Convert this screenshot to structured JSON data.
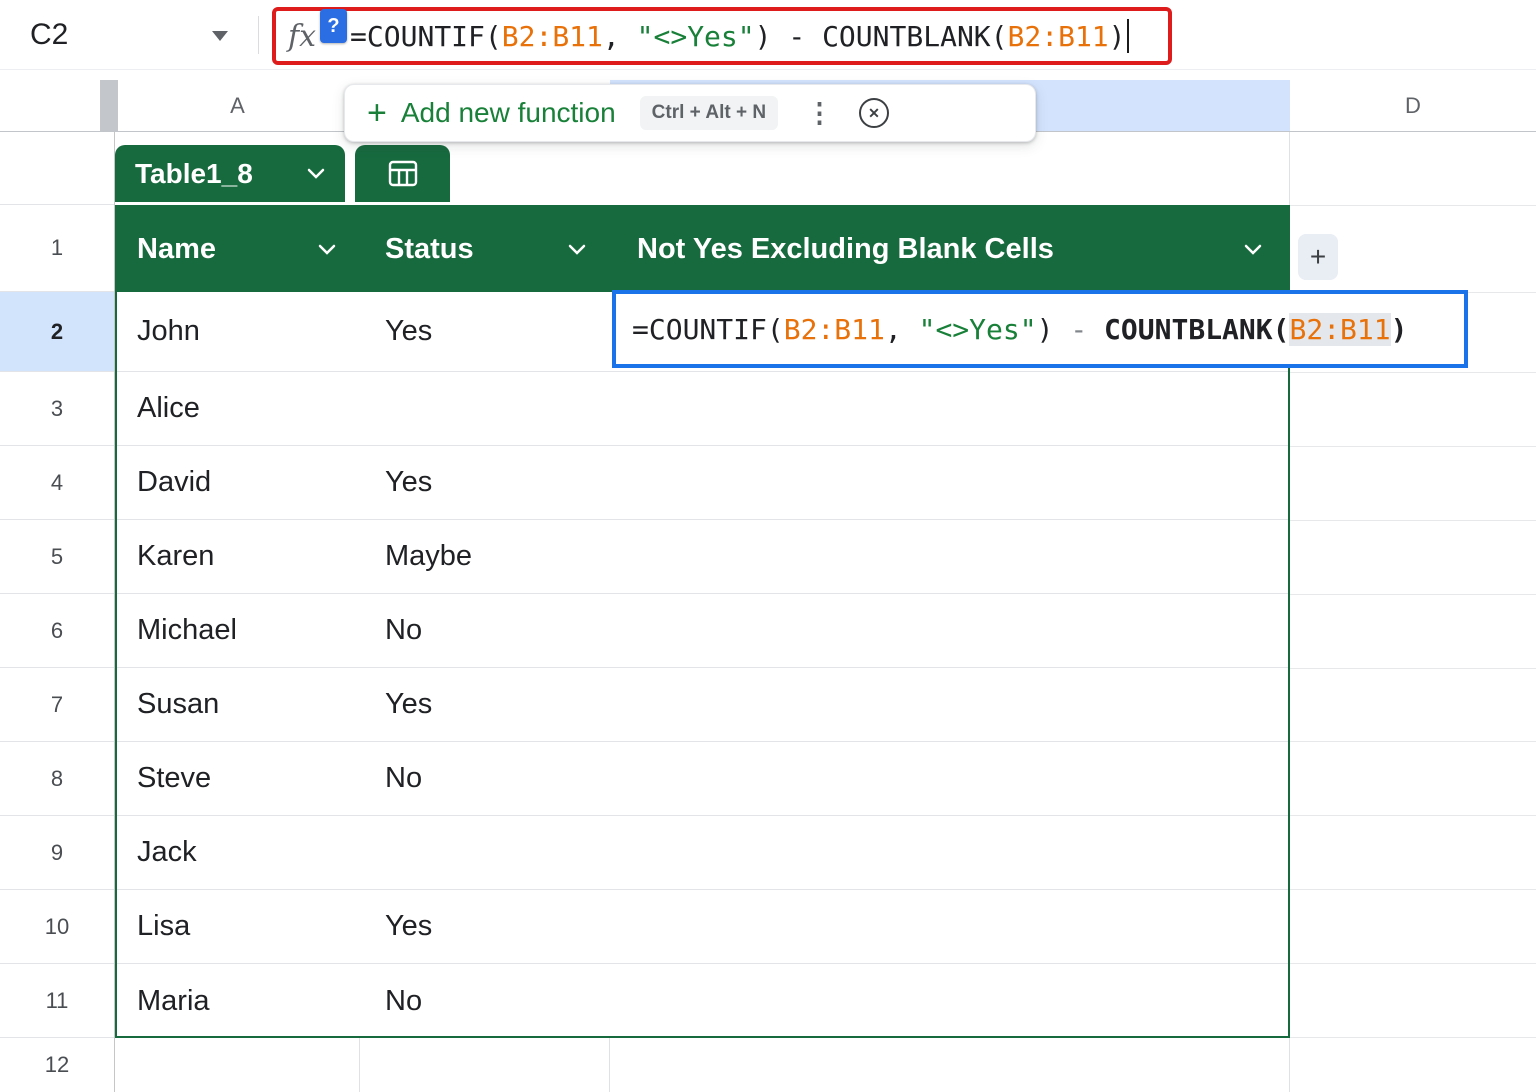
{
  "colors": {
    "ink": "#202124",
    "range_orange": "#e8710a",
    "string_green": "#188038",
    "operator_gray": "#80868b",
    "header_green": "#17693e",
    "selection_blue": "#1a73e8",
    "attention_red": "#de1c1c",
    "selected_row_fill": "#d2e3fc",
    "selected_col_fill": "#d3e3fd",
    "arg_highlight": "#e4e7eb"
  },
  "icons": {
    "plus": "+",
    "more_options": "⋮",
    "close": "✕"
  },
  "name_box": {
    "value": "C2"
  },
  "formula_bar": {
    "fx_label": "fx",
    "help_badge": "?",
    "tokens": [
      {
        "t": "=COUNTIF(",
        "c": "ink"
      },
      {
        "t": "B2:B11",
        "c": "range_orange"
      },
      {
        "t": ", ",
        "c": "ink"
      },
      {
        "t": "\"<>Yes\"",
        "c": "string_green"
      },
      {
        "t": ") ",
        "c": "ink"
      },
      {
        "t": "- ",
        "c": "ink"
      },
      {
        "t": "COUNTBLANK(",
        "c": "ink"
      },
      {
        "t": "B2:B11",
        "c": "range_orange"
      },
      {
        "t": ")",
        "c": "ink"
      }
    ]
  },
  "function_tooltip": {
    "add_label": "Add new function",
    "shortcut": "Ctrl + Alt + N"
  },
  "column_headers": {
    "a": "A",
    "d": "D"
  },
  "table": {
    "name": "Table1_8",
    "columns": [
      "Name",
      "Status",
      "Not Yes Excluding Blank Cells"
    ],
    "add_column_label": "+",
    "header_row_number": "1",
    "trailing_row_number": "12",
    "rows": [
      {
        "row": "2",
        "name": "John",
        "status": "Yes"
      },
      {
        "row": "3",
        "name": "Alice",
        "status": ""
      },
      {
        "row": "4",
        "name": "David",
        "status": "Yes"
      },
      {
        "row": "5",
        "name": "Karen",
        "status": "Maybe"
      },
      {
        "row": "6",
        "name": "Michael",
        "status": "No"
      },
      {
        "row": "7",
        "name": "Susan",
        "status": "Yes"
      },
      {
        "row": "8",
        "name": "Steve",
        "status": "No"
      },
      {
        "row": "9",
        "name": "Jack",
        "status": ""
      },
      {
        "row": "10",
        "name": "Lisa",
        "status": "Yes"
      },
      {
        "row": "11",
        "name": "Maria",
        "status": "No"
      }
    ]
  },
  "cell_editor": {
    "tokens": [
      {
        "t": "=COUNTIF(",
        "c": "ink"
      },
      {
        "t": "B2:B11",
        "c": "range_orange"
      },
      {
        "t": ", ",
        "c": "ink"
      },
      {
        "t": "\"<>Yes\"",
        "c": "string_green"
      },
      {
        "t": ") ",
        "c": "ink"
      },
      {
        "t": "- ",
        "c": "operator_gray"
      },
      {
        "t": "COUNTBLANK(",
        "c": "ink",
        "bold": true
      },
      {
        "t": "B2:B11",
        "c": "range_orange",
        "hl": true
      },
      {
        "t": ")",
        "c": "ink",
        "bold": true
      }
    ]
  }
}
